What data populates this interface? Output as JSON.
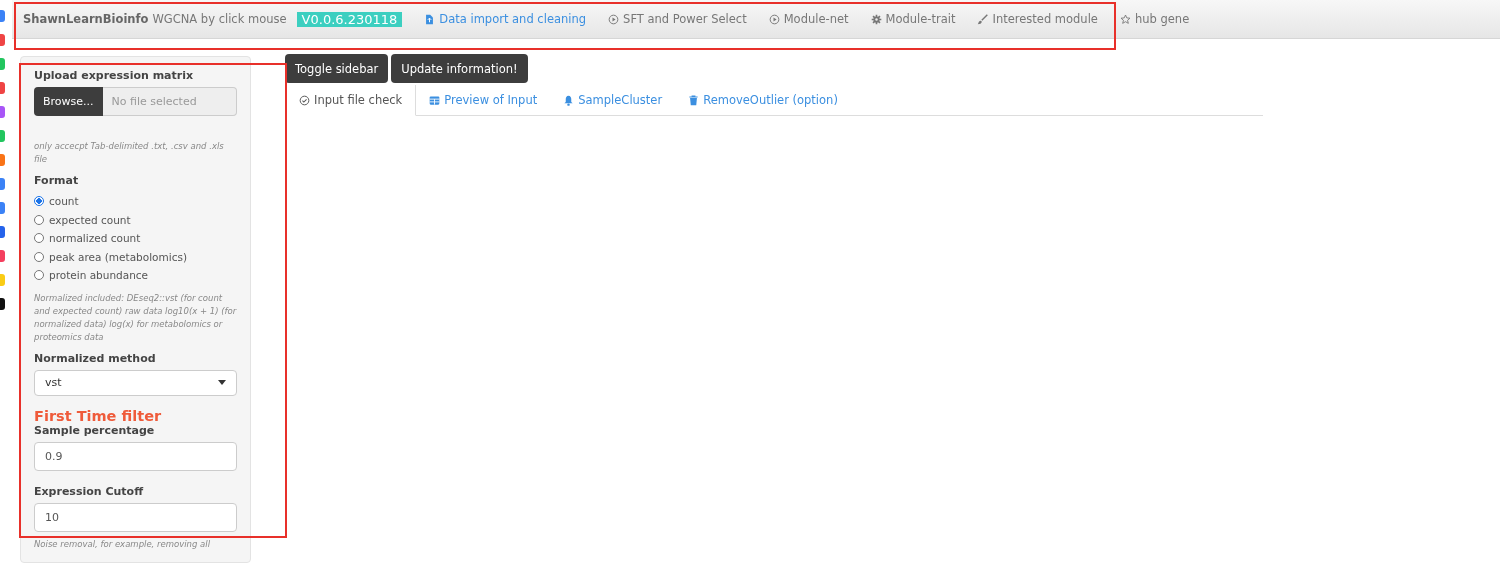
{
  "navbar": {
    "brand": "ShawnLearnBioinfo",
    "subtitle": "WGCNA by click mouse",
    "version": "V0.0.6.230118",
    "items": [
      {
        "label": "Data import and cleaning",
        "selected": true
      },
      {
        "label": "SFT and Power Select",
        "selected": false
      },
      {
        "label": "Module-net",
        "selected": false
      },
      {
        "label": "Module-trait",
        "selected": false
      },
      {
        "label": "Interested module",
        "selected": false
      },
      {
        "label": "hub gene",
        "selected": false
      }
    ]
  },
  "sidebar": {
    "upload": {
      "label": "Upload expression matrix",
      "button": "Browse...",
      "placeholder": "No file selected",
      "help": "only accecpt Tab-delimited .txt, .csv and .xls file"
    },
    "format": {
      "label": "Format",
      "options": [
        {
          "label": "count",
          "selected": true
        },
        {
          "label": "expected count",
          "selected": false
        },
        {
          "label": "normalized count",
          "selected": false
        },
        {
          "label": "peak area (metabolomics)",
          "selected": false
        },
        {
          "label": "protein abundance",
          "selected": false
        }
      ],
      "help": "Normalized included: DEseq2::vst (for count and expected count) raw data log10(x + 1) (for normalized data) log(x) for metabolomics or proteomics data"
    },
    "method": {
      "label": "Normalized method",
      "value": "vst"
    },
    "filter_heading": "First Time filter",
    "sample_percentage": {
      "label": "Sample percentage",
      "value": "0.9"
    },
    "expression_cutoff": {
      "label": "Expression Cutoff",
      "value": "10"
    },
    "cut_help": "Noise removal, for example, removing all"
  },
  "buttons": [
    "Toggle sidebar",
    "Update information!"
  ],
  "tabs": [
    {
      "label": "Input file check",
      "selected": true
    },
    {
      "label": "Preview of Input",
      "selected": false
    },
    {
      "label": "SampleCluster",
      "selected": false
    },
    {
      "label": "RemoveOutlier (option)",
      "selected": false
    }
  ]
}
